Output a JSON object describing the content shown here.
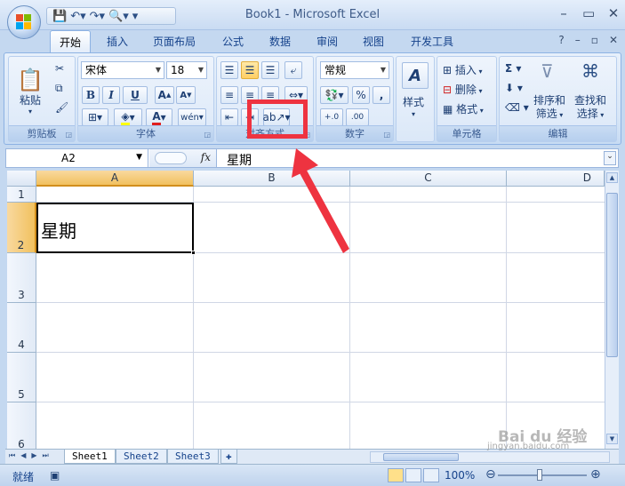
{
  "window": {
    "title": "Book1 - Microsoft Excel"
  },
  "tabs": [
    "开始",
    "插入",
    "页面布局",
    "公式",
    "数据",
    "审阅",
    "视图",
    "开发工具"
  ],
  "clipboard": {
    "paste_label": "粘贴",
    "group_label": "剪贴板"
  },
  "font": {
    "name": "宋体",
    "size": "18",
    "group_label": "字体",
    "bold": "B",
    "italic": "I",
    "underline": "U"
  },
  "alignment": {
    "group_label": "对齐方式"
  },
  "number": {
    "format": "常规",
    "group_label": "数字",
    "percent": "%",
    "comma": ","
  },
  "styles": {
    "label": "样式"
  },
  "cells": {
    "insert": "插入",
    "delete": "删除",
    "format": "格式",
    "group_label": "单元格"
  },
  "editing": {
    "sort_filter": "排序和\n筛选",
    "find_select": "查找和\n选择",
    "group_label": "编辑",
    "sort_line1": "排序和",
    "sort_line2": "筛选",
    "find_line1": "查找和",
    "find_line2": "选择"
  },
  "formula_bar": {
    "name_box": "A2",
    "fx": "fx",
    "content": "星期"
  },
  "grid": {
    "columns": [
      "A",
      "B",
      "C",
      "D"
    ],
    "rows": [
      "1",
      "2",
      "3",
      "4",
      "5",
      "6"
    ],
    "active_cell_value": "星期"
  },
  "sheets": [
    "Sheet1",
    "Sheet2",
    "Sheet3"
  ],
  "status": {
    "ready": "就绪",
    "zoom": "100%"
  },
  "watermark": {
    "line1": "Bai du 经验",
    "line2": "jingyan.baidu.com"
  },
  "colors": {
    "highlight_red": "#ee3340",
    "ribbon_bg": "#d7e6f7",
    "selection_orange": "#f1c15f"
  }
}
